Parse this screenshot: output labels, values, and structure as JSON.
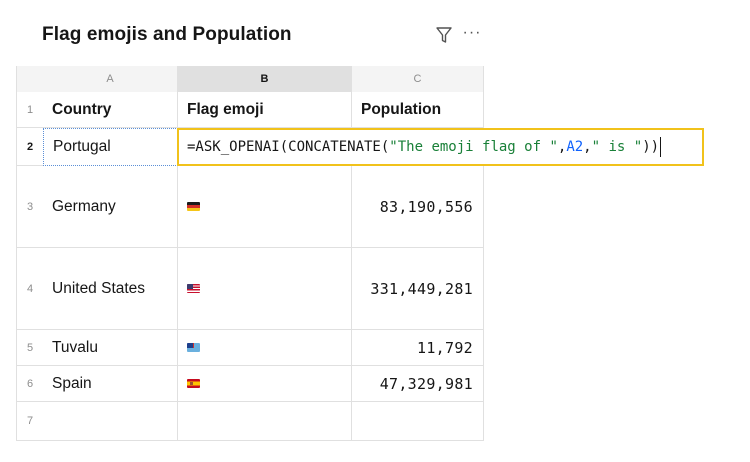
{
  "sheet": {
    "title": "Flag emojis and Population",
    "more_label": "···"
  },
  "columns": [
    {
      "letter": "A",
      "header": "Country"
    },
    {
      "letter": "B",
      "header": "Flag emoji"
    },
    {
      "letter": "C",
      "header": "Population"
    }
  ],
  "selected_column": "B",
  "rows": [
    {
      "num": "1"
    },
    {
      "num": "2",
      "country": "Portugal"
    },
    {
      "num": "3",
      "country": "Germany",
      "flag": "germany-flag-icon",
      "population": "83,190,556"
    },
    {
      "num": "4",
      "country": "United States",
      "flag": "united-states-flag-icon",
      "population": "331,449,281"
    },
    {
      "num": "5",
      "country": "Tuvalu",
      "flag": "tuvalu-flag-icon",
      "population": "11,792"
    },
    {
      "num": "6",
      "country": "Spain",
      "flag": "spain-flag-icon",
      "population": "47,329,981"
    },
    {
      "num": "7"
    }
  ],
  "editor": {
    "prefix": "=ASK_OPENAI(CONCATENATE(",
    "string1": "\"The emoji flag of \"",
    "comma1": ",",
    "ref": "A2",
    "comma2": ",",
    "string2": "\" is \"",
    "suffix": "))"
  },
  "colors": {
    "accent_border": "#f1c21b",
    "string_color": "#198038",
    "reference_color": "#0f62fe"
  }
}
